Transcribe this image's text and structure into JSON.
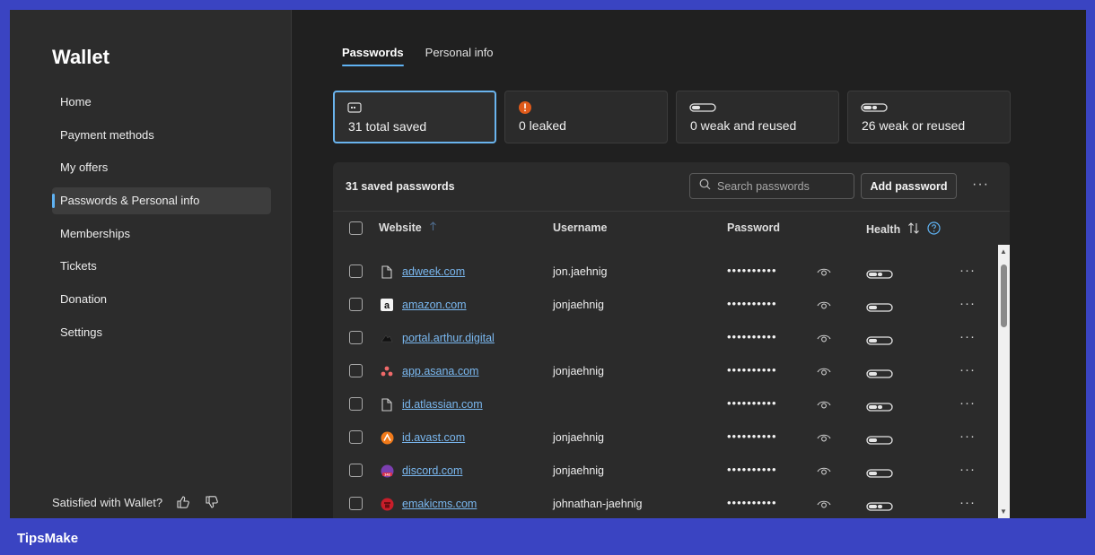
{
  "app": {
    "title": "Wallet"
  },
  "sidebar": {
    "items": [
      {
        "label": "Home"
      },
      {
        "label": "Payment methods"
      },
      {
        "label": "My offers"
      },
      {
        "label": "Passwords & Personal info",
        "active": true
      },
      {
        "label": "Memberships"
      },
      {
        "label": "Tickets"
      },
      {
        "label": "Donation"
      },
      {
        "label": "Settings"
      }
    ],
    "feedback_label": "Satisfied with Wallet?"
  },
  "tabs": [
    {
      "label": "Passwords",
      "active": true
    },
    {
      "label": "Personal info"
    }
  ],
  "cards": [
    {
      "label": "31 total saved",
      "icon": "password-card-icon"
    },
    {
      "label": "0 leaked",
      "icon": "alert-icon"
    },
    {
      "label": "0 weak and reused",
      "icon": "strength-bar-icon"
    },
    {
      "label": "26 weak or reused",
      "icon": "strength-bar-icon"
    }
  ],
  "panel": {
    "title": "31 saved passwords",
    "search_placeholder": "Search passwords",
    "add_button": "Add password",
    "columns": {
      "website": "Website",
      "username": "Username",
      "password": "Password",
      "health": "Health"
    }
  },
  "rows": [
    {
      "website": "adweek.com",
      "username": "jon.jaehnig",
      "password": "••••••••••",
      "icon": "file-icon"
    },
    {
      "website": "amazon.com",
      "username": "jonjaehnig",
      "password": "••••••••••",
      "icon": "amazon-icon"
    },
    {
      "website": "portal.arthur.digital",
      "username": "",
      "password": "••••••••••",
      "icon": "arthur-icon"
    },
    {
      "website": "app.asana.com",
      "username": "jonjaehnig",
      "password": "••••••••••",
      "icon": "asana-icon"
    },
    {
      "website": "id.atlassian.com",
      "username": "",
      "password": "••••••••••",
      "icon": "file-icon"
    },
    {
      "website": "id.avast.com",
      "username": "jonjaehnig",
      "password": "••••••••••",
      "icon": "avast-icon"
    },
    {
      "website": "discord.com",
      "username": "jonjaehnig",
      "password": "••••••••••",
      "icon": "discord-icon"
    },
    {
      "website": "emakicms.com",
      "username": "johnathan-jaehnig",
      "password": "••••••••••",
      "icon": "emaki-icon"
    }
  ],
  "watermark": {
    "brand": "TipsMake"
  },
  "colors": {
    "accent": "#5fb2f2",
    "link": "#7ab8f0",
    "alert": "#e05a1a",
    "frame": "#3a44c2"
  }
}
